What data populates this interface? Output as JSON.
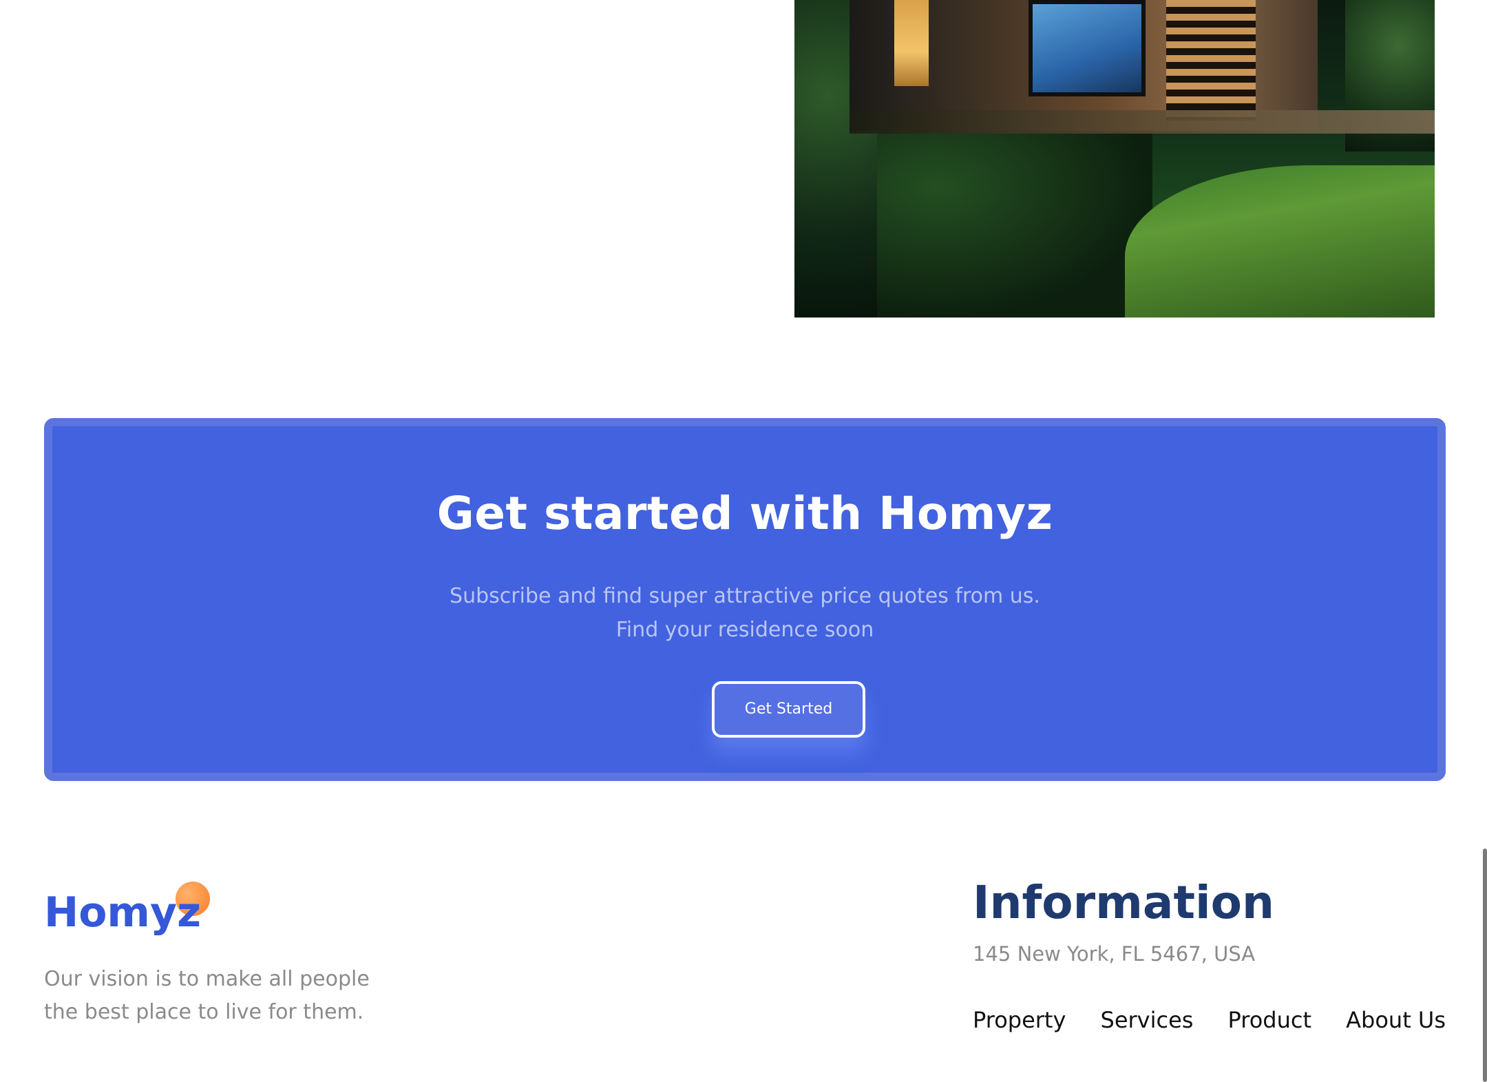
{
  "hero": {
    "image_alt": "Modern house with lit windows surrounded by trees and lawn"
  },
  "cta": {
    "title": "Get started with Homyz",
    "subtitle_line1": "Subscribe and find super attractive price quotes from us.",
    "subtitle_line2": "Find your residence soon",
    "button_label": "Get Started"
  },
  "footer": {
    "logo": "Homyz",
    "vision_line1": "Our vision is to make all people",
    "vision_line2": "the best place to live for them.",
    "info_title": "Information",
    "address": "145 New York, FL 5467, USA",
    "nav": [
      "Property",
      "Services",
      "Product",
      "About Us"
    ]
  },
  "colors": {
    "banner_bg": "#4262df",
    "banner_border": "#5c74dd",
    "logo_blue": "#3458d8",
    "logo_dot": "#fb8c3c",
    "info_title": "#1f3a6e",
    "muted_text": "#8a8a8a"
  }
}
